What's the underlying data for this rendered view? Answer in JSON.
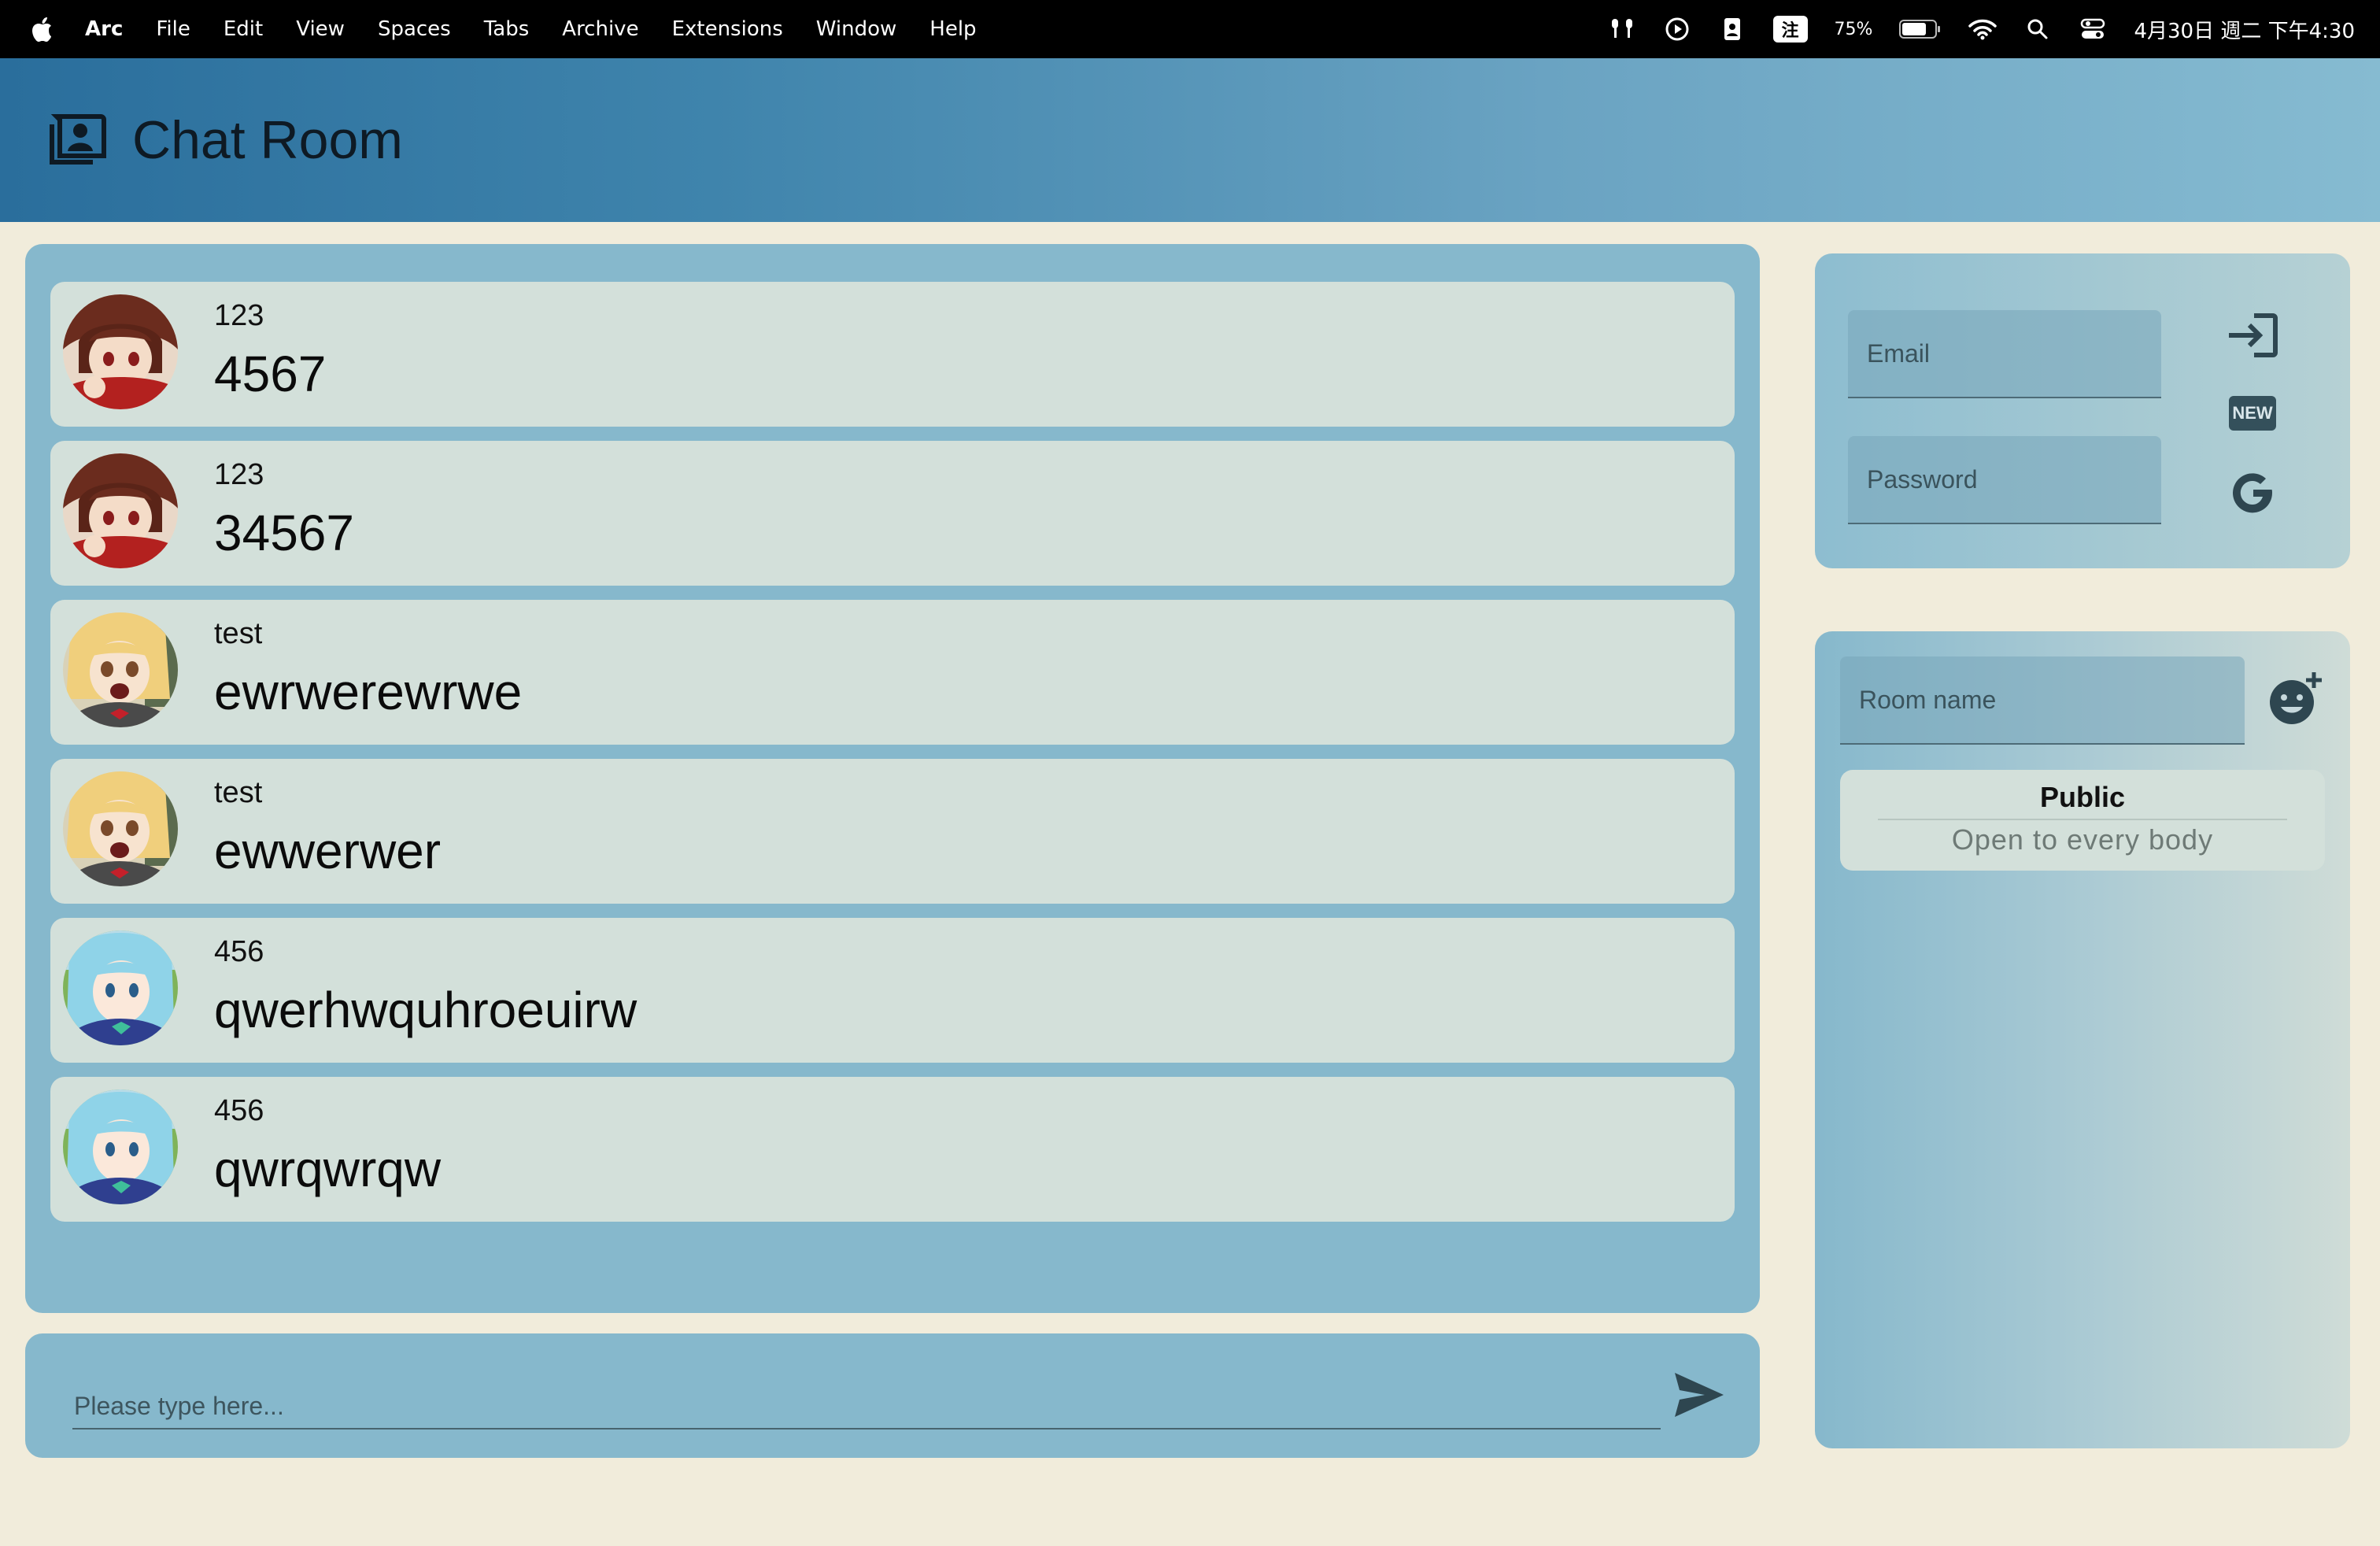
{
  "menubar": {
    "items": [
      "Arc",
      "File",
      "Edit",
      "View",
      "Spaces",
      "Tabs",
      "Archive",
      "Extensions",
      "Window",
      "Help"
    ],
    "ime_label": "注",
    "battery_percent": "75%",
    "battery_level": 0.75,
    "clock": "4月30日 週二 下午4:30"
  },
  "header": {
    "title": "Chat Room"
  },
  "messages": [
    {
      "user": "123",
      "text": "4567",
      "avatar": "red-haired-girl"
    },
    {
      "user": "123",
      "text": "34567",
      "avatar": "red-haired-girl"
    },
    {
      "user": "test",
      "text": "ewrwerewrwe",
      "avatar": "blonde-girl"
    },
    {
      "user": "test",
      "text": "ewwerwer",
      "avatar": "blonde-girl"
    },
    {
      "user": "456",
      "text": "qwerhwquhroeuirw",
      "avatar": "blue-haired-girl"
    },
    {
      "user": "456",
      "text": "qwrqwrqw",
      "avatar": "blue-haired-girl"
    }
  ],
  "compose": {
    "placeholder": "Please type here..."
  },
  "login": {
    "email_placeholder": "Email",
    "password_placeholder": "Password",
    "new_label": "NEW"
  },
  "rooms": {
    "room_name_placeholder": "Room name",
    "public_title": "Public",
    "public_subtitle": "Open to every body"
  },
  "colors": {
    "background": "#f1ecdb",
    "panel": "#86b8cc",
    "card": "#d3e0da",
    "header_start": "#2a6e9c",
    "header_end": "#86bbd1"
  }
}
